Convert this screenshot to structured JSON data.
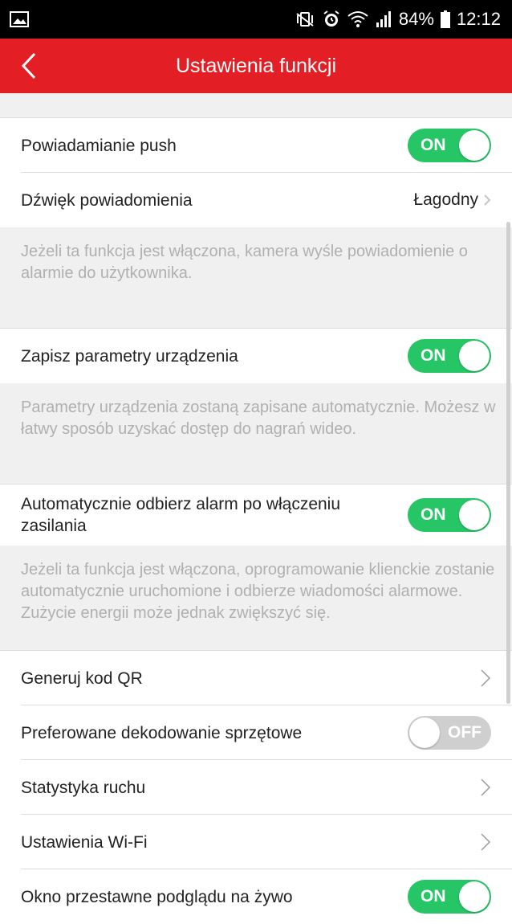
{
  "status_bar": {
    "icons_left": [
      "image-icon"
    ],
    "icons_right": [
      "vibrate-icon",
      "alarm-icon",
      "wifi-icon",
      "signal-icon"
    ],
    "battery": "84%",
    "time": "12:12"
  },
  "header": {
    "title": "Ustawienia funkcji",
    "background_color": "#e31e24"
  },
  "settings": {
    "push": {
      "label": "Powiadamianie push",
      "toggle": "ON"
    },
    "sound": {
      "label": "Dźwięk powiadomienia",
      "value": "Łagodny"
    },
    "push_desc": "Jeżeli ta funkcja jest włączona, kamera wyśle powiadomienie o alarmie do użytkownika.",
    "save_params": {
      "label": "Zapisz parametry urządzenia",
      "toggle": "ON"
    },
    "save_params_desc": "Parametry urządzenia zostaną zapisane automatycznie. Możesz w łatwy sposób uzyskać dostęp do nagrań wideo.",
    "auto_receive": {
      "label": "Automatycznie odbierz alarm po włączeniu zasilania",
      "toggle": "ON"
    },
    "auto_receive_desc": "Jeżeli ta funkcja jest włączona, oprogramowanie klienckie zostanie automatycznie uruchomione i odbierze wiadomości alarmowe. Zużycie energii może jednak zwiększyć się.",
    "qr": {
      "label": "Generuj kod QR"
    },
    "hw_decoding": {
      "label": "Preferowane dekodowanie sprzętowe",
      "toggle": "OFF"
    },
    "traffic": {
      "label": "Statystyka ruchu"
    },
    "wifi": {
      "label": "Ustawienia Wi-Fi"
    },
    "live_window": {
      "label": "Okno przestawne podglądu na żywo",
      "toggle": "ON"
    }
  },
  "colors": {
    "toggle_on": "#26c565",
    "toggle_off": "#cfcfcf",
    "description_text": "#b0b0b0"
  }
}
